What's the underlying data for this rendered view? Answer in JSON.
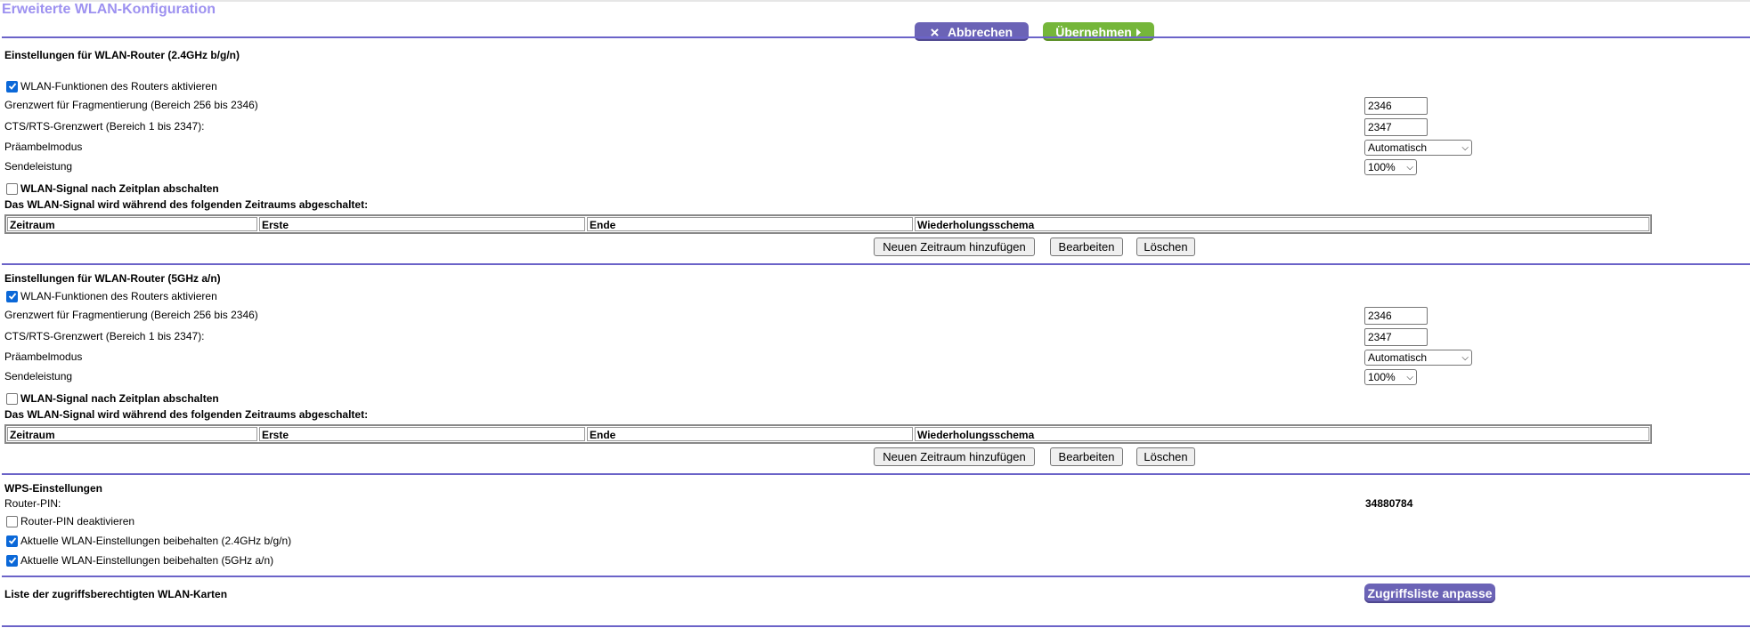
{
  "page": {
    "title": "Erweiterte WLAN-Konfiguration"
  },
  "toolbar": {
    "cancel_label": "Abbrechen",
    "apply_label": "Übernehmen"
  },
  "band24": {
    "title": "Einstellungen für WLAN-Router (2.4GHz b/g/n)",
    "enable_label": "WLAN-Funktionen des Routers aktivieren",
    "enable_checked": true,
    "frag_label": "Grenzwert für Fragmentierung (Bereich 256 bis 2346)",
    "frag_value": "2346",
    "cts_label": "CTS/RTS-Grenzwert (Bereich 1 bis 2347):",
    "cts_value": "2347",
    "preamble_label": "Präambelmodus",
    "preamble_value": "Automatisch",
    "power_label": "Sendeleistung",
    "power_value": "100%",
    "schedule_label": "WLAN-Signal nach Zeitplan abschalten",
    "schedule_checked": false,
    "off_period_label": "Das WLAN-Signal wird während des folgenden Zeitraums abgeschaltet:",
    "table_headers": [
      "Zeitraum",
      "Erste",
      "Ende",
      "Wiederholungsschema"
    ],
    "add_label": "Neuen Zeitraum hinzufügen",
    "edit_label": "Bearbeiten",
    "delete_label": "Löschen"
  },
  "band5": {
    "title": "Einstellungen für WLAN-Router (5GHz a/n)",
    "enable_label": "WLAN-Funktionen des Routers aktivieren",
    "enable_checked": true,
    "frag_label": "Grenzwert für Fragmentierung (Bereich 256 bis 2346)",
    "frag_value": "2346",
    "cts_label": "CTS/RTS-Grenzwert (Bereich 1 bis 2347):",
    "cts_value": "2347",
    "preamble_label": "Präambelmodus",
    "preamble_value": "Automatisch",
    "power_label": "Sendeleistung",
    "power_value": "100%",
    "schedule_label": "WLAN-Signal nach Zeitplan abschalten",
    "schedule_checked": false,
    "off_period_label": "Das WLAN-Signal wird während des folgenden Zeitraums abgeschaltet:",
    "table_headers": [
      "Zeitraum",
      "Erste",
      "Ende",
      "Wiederholungsschema"
    ],
    "add_label": "Neuen Zeitraum hinzufügen",
    "edit_label": "Bearbeiten",
    "delete_label": "Löschen"
  },
  "wps": {
    "title": "WPS-Einstellungen",
    "pin_label": "Router-PIN:",
    "pin_value": "34880784",
    "disable_pin_label": "Router-PIN deaktivieren",
    "disable_pin_checked": false,
    "keep24_label": "Aktuelle WLAN-Einstellungen beibehalten (2.4GHz b/g/n)",
    "keep24_checked": true,
    "keep5_label": "Aktuelle WLAN-Einstellungen beibehalten (5GHz a/n)",
    "keep5_checked": true
  },
  "access": {
    "label": "Liste der zugriffsberechtigten WLAN-Karten",
    "button_label": "Zugriffsliste anpasse"
  },
  "colors": {
    "accent": "#6b63c8",
    "title_color": "#9d91f0",
    "apply_green": "#75b63a",
    "checkbox_blue": "#0b68d8"
  }
}
